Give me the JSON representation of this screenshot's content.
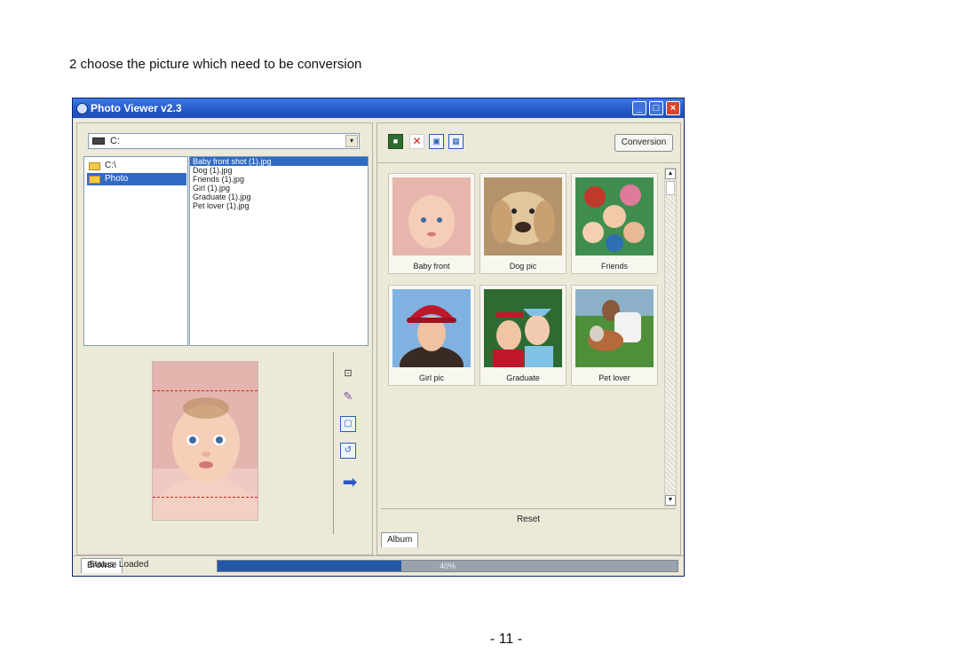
{
  "document": {
    "instruction": "2 choose the picture which need to be conversion",
    "page_number": "- 11 -"
  },
  "window": {
    "title": "Photo Viewer v2.3",
    "controls": {
      "minimize": "_",
      "maximize": "□",
      "close": "×"
    }
  },
  "left_pane": {
    "drive_select": {
      "value": "C:"
    },
    "folder_tree": [
      {
        "label": "C:\\",
        "selected": false
      },
      {
        "label": "Photo",
        "selected": true
      }
    ],
    "file_list": [
      {
        "label": "Baby front shot (1).jpg",
        "selected": true
      },
      {
        "label": "Dog (1).jpg",
        "selected": false
      },
      {
        "label": "Friends (1).jpg",
        "selected": false
      },
      {
        "label": "Girl (1).jpg",
        "selected": false
      },
      {
        "label": "Graduate (1).jpg",
        "selected": false
      },
      {
        "label": "Pet lover (1).jpg",
        "selected": false
      }
    ],
    "tab_label": "Browse"
  },
  "right_pane": {
    "convert_button": "Conversion",
    "thumbnails": [
      {
        "caption": "Baby front",
        "kind": "baby"
      },
      {
        "caption": "Dog pic",
        "kind": "dog"
      },
      {
        "caption": "Friends",
        "kind": "friends"
      },
      {
        "caption": "Girl pic",
        "kind": "girl"
      },
      {
        "caption": "Graduate",
        "kind": "graduate"
      },
      {
        "caption": "Pet lover",
        "kind": "petlover"
      }
    ],
    "reset_label": "Reset",
    "tab_label": "Album"
  },
  "status": {
    "text": "Status: Loaded",
    "progress_label": "40%",
    "progress_fraction": 0.4
  },
  "colors": {
    "titlebar": "#2458c6",
    "selection": "#316ac5",
    "progress": "#2557a8",
    "window_bg": "#ece9d8"
  }
}
